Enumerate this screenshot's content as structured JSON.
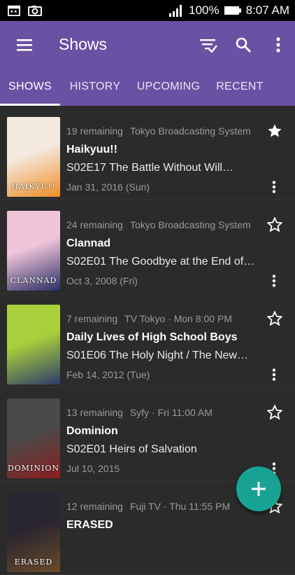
{
  "status_bar": {
    "battery": "100%",
    "time": "8:07 AM"
  },
  "app_bar": {
    "title": "Shows"
  },
  "tabs": [
    {
      "label": "SHOWS",
      "active": true
    },
    {
      "label": "HISTORY",
      "active": false
    },
    {
      "label": "UPCOMING",
      "active": false
    },
    {
      "label": "RECENT",
      "active": false
    }
  ],
  "shows": [
    {
      "remaining": "19 remaining",
      "network": "Tokyo Broadcasting System",
      "title": "Haikyuu!!",
      "episode": "S02E17 The Battle Without Will…",
      "date": "Jan 31, 2016 (Sun)",
      "favorite": true,
      "poster_text": "HAIKYU!!",
      "poster_colors": [
        "#f3e9df",
        "#f08f27"
      ]
    },
    {
      "remaining": "24 remaining",
      "network": "Tokyo Broadcasting System",
      "title": "Clannad",
      "episode": "S02E01 The Goodbye at the End of…",
      "date": "Oct 3, 2008 (Fri)",
      "favorite": false,
      "poster_text": "CLANNAD",
      "poster_colors": [
        "#f0c4d9",
        "#2a2f66"
      ]
    },
    {
      "remaining": "7 remaining",
      "network": "TV Tokyo · Mon 8:00 PM",
      "title": "Daily Lives of High School Boys",
      "episode": "S01E06 The Holy Night / The New…",
      "date": "Feb 14, 2012 (Tue)",
      "favorite": false,
      "poster_text": "",
      "poster_colors": [
        "#a9cf3a",
        "#2d3b6b"
      ]
    },
    {
      "remaining": "13 remaining",
      "network": "Syfy · Fri 11:00 AM",
      "title": "Dominion",
      "episode": "S02E01 Heirs of Salvation",
      "date": "Jul 10, 2015",
      "favorite": false,
      "poster_text": "DOMINION",
      "poster_colors": [
        "#4a4a4a",
        "#8a1f1f"
      ]
    },
    {
      "remaining": "12 remaining",
      "network": "Fuji TV · Thu 11:55 PM",
      "title": "ERASED",
      "episode": "",
      "date": "",
      "favorite": false,
      "poster_text": "ERASED",
      "poster_colors": [
        "#2a2630",
        "#6b4a2a"
      ]
    }
  ],
  "colors": {
    "primary": "#6a51a3",
    "fab": "#18a294",
    "background": "#2b2b2b"
  }
}
